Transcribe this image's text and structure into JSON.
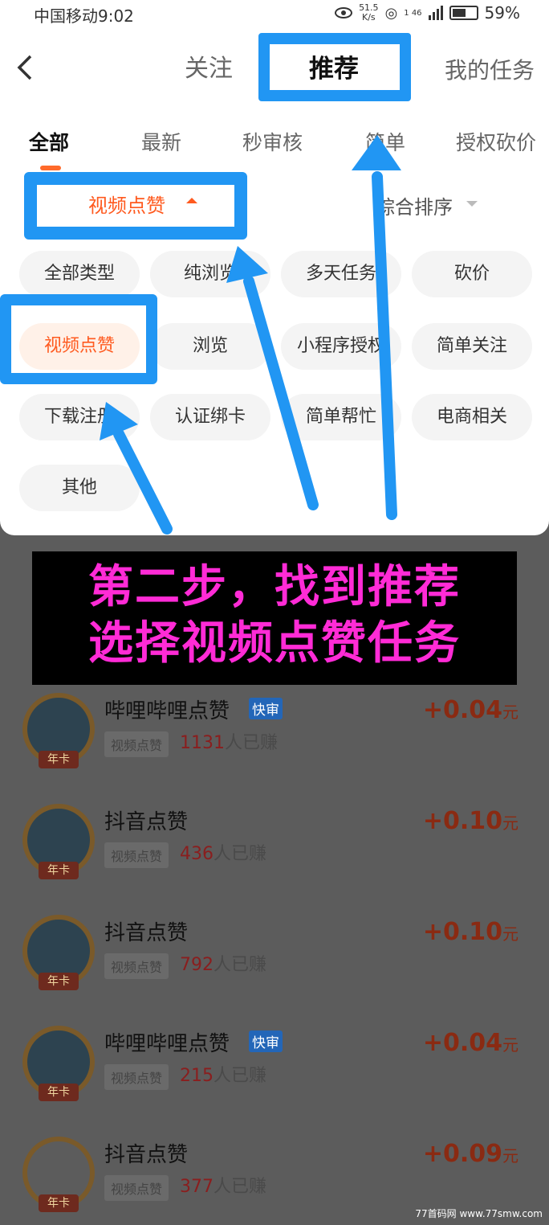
{
  "status_bar": {
    "carrier": "中国移动9:02",
    "net_speed_value": "51.5",
    "net_speed_unit": "K/s",
    "signal_label": "1 46",
    "battery": "59%"
  },
  "top_tabs": {
    "follow": "关注",
    "recommend": "推荐",
    "my_tasks": "我的任务"
  },
  "sub_tabs": [
    "全部",
    "最新",
    "秒审核",
    "简单",
    "授权砍价"
  ],
  "filter": {
    "label": "视频点赞",
    "sort": "综合排序"
  },
  "chips": [
    "全部类型",
    "纯浏览",
    "多天任务",
    "砍价",
    "视频点赞",
    "浏览",
    "小程序授权",
    "简单关注",
    "下载注册",
    "认证绑卡",
    "简单帮忙",
    "电商相关",
    "其他"
  ],
  "banner": {
    "line1": "第二步，找到推荐",
    "line2": "选择视频点赞任务"
  },
  "tasks": [
    {
      "title": "哔哩哔哩点赞",
      "fast": "快审",
      "tag": "视频点赞",
      "count": "1131",
      "suffix": "人已赚",
      "price": "+0.04",
      "unit": "元",
      "badge": "年卡"
    },
    {
      "title": "抖音点赞",
      "fast": "",
      "tag": "视频点赞",
      "count": "436",
      "suffix": "人已赚",
      "price": "+0.10",
      "unit": "元",
      "badge": "年卡"
    },
    {
      "title": "抖音点赞",
      "fast": "",
      "tag": "视频点赞",
      "count": "792",
      "suffix": "人已赚",
      "price": "+0.10",
      "unit": "元",
      "badge": "年卡"
    },
    {
      "title": "哔哩哔哩点赞",
      "fast": "快审",
      "tag": "视频点赞",
      "count": "215",
      "suffix": "人已赚",
      "price": "+0.04",
      "unit": "元",
      "badge": "年卡"
    },
    {
      "title": "抖音点赞",
      "fast": "",
      "tag": "视频点赞",
      "count": "377",
      "suffix": "人已赚",
      "price": "+0.09",
      "unit": "元",
      "badge": "年卡"
    }
  ],
  "watermark": "77首码网 www.77smw.com",
  "colors": {
    "accent": "#ff5a1f",
    "annotation_blue": "#2196f3",
    "banner_text": "#ff2bd6"
  }
}
